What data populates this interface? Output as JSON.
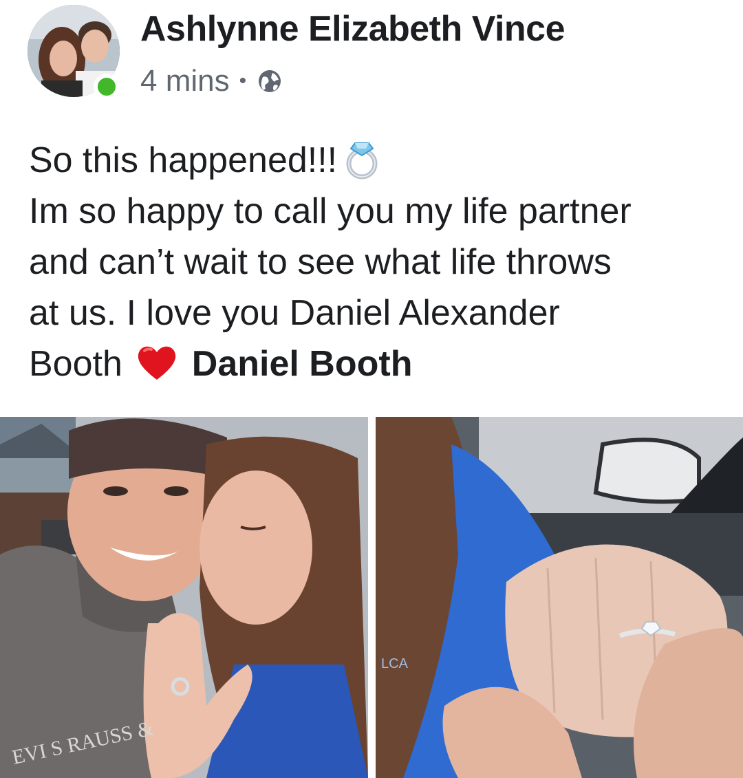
{
  "post": {
    "author_name": "Ashlynne Elizabeth Vince",
    "timestamp": "4 mins",
    "separator": "•",
    "privacy_icon": "globe-icon",
    "online_indicator_color": "#42b72a",
    "text_lines": [
      "So this happened!!!",
      "Im so happy to call you my life partner",
      "and can’t wait to see what life throws",
      "at us. I love you Daniel Alexander",
      "Booth"
    ],
    "emoji_after_line_1": "ring-emoji",
    "emoji_after_line_5": "red-heart-emoji",
    "tagged_user": "Daniel Booth",
    "photos": [
      {
        "name": "couple-selfie-photo"
      },
      {
        "name": "engagement-ring-hand-photo"
      }
    ]
  },
  "colors": {
    "name_text": "#1c1e21",
    "meta_text": "#606770",
    "heart": "#e0141e"
  }
}
